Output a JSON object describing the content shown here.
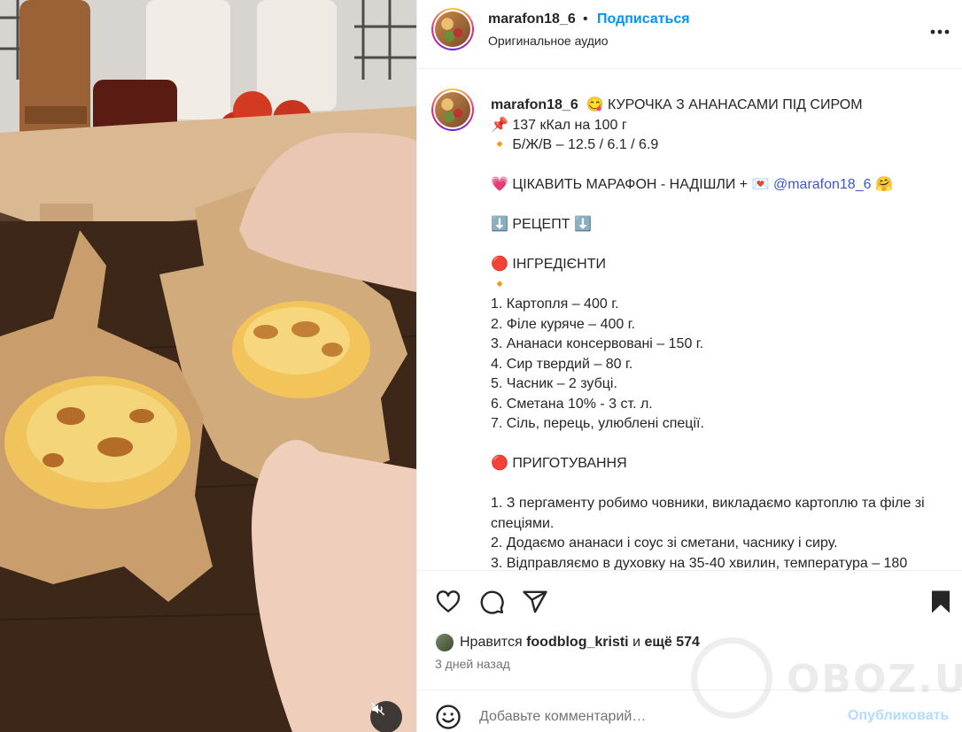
{
  "header": {
    "username": "marafon18_6",
    "separator": "•",
    "follow_label": "Подписаться",
    "audio_label": "Оригинальное аудио",
    "more_icon": "more-horizontal-icon"
  },
  "caption": {
    "username": "marafon18_6",
    "lines": [
      "😋 КУРОЧКА З АНАНАСАМИ ПІД СИРОМ",
      "📌 137 кКал на 100 г",
      "🔸 Б/Ж/В – 12.5 / 6.1 / 6.9",
      "",
      "💗 ЦІКАВИТЬ МАРАФОН - НАДІШЛИ + 💌 ",
      "",
      "⬇️ РЕЦЕПТ ⬇️",
      "",
      "🔴 ІНГРЕДІЄНТИ",
      "🔸",
      "1. Картопля – 400 г.",
      "2. Філе куряче – 400 г.",
      "3. Ананаси консервовані – 150 г.",
      "4. Сир твердий – 80 г.",
      "5. Часник – 2 зубці.",
      "6. Сметана 10% - 3 ст. л.",
      "7. Сіль, перець, улюблені спеції.",
      "",
      "🔴 ПРИГОТУВАННЯ",
      "",
      "1. З пергаменту робимо човники, викладаємо картоплю та філе зі спеціями.",
      "2. Додаємо ананаси і соус зі сметани, часнику і сиру.",
      "3. Відправляємо в духовку на 35-40 хвилин, температура – 180"
    ],
    "mention": "@marafon18_6",
    "mention_suffix": " 🤗"
  },
  "actions": {
    "like_icon": "heart-icon",
    "comment_icon": "comment-icon",
    "share_icon": "share-icon",
    "save_icon": "bookmark-icon"
  },
  "likes": {
    "prefix": "Нравится ",
    "user": "foodblog_kristi",
    "middle": " и ",
    "more": "ещё 574"
  },
  "date": "3 дней назад",
  "comment": {
    "placeholder": "Добавьте комментарий…",
    "publish_label": "Опубликовать",
    "emoji_icon": "smiley-icon"
  },
  "media": {
    "mute_icon": "speaker-muted-icon"
  },
  "watermark": {
    "text": "OBOZ.UA"
  },
  "colors": {
    "accent": "#0095f6",
    "mention": "#3b59c6",
    "publish_disabled": "#b3dbff",
    "muted_text": "#737373"
  }
}
